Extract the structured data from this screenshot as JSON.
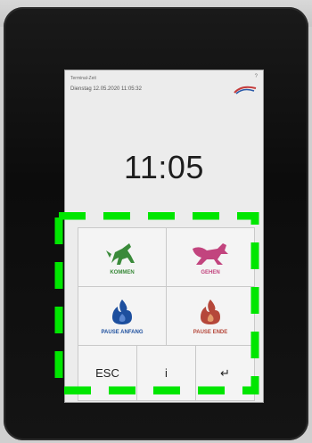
{
  "header": {
    "device_name": "Terminal-Zeit",
    "datetime": "Dienstag 12.05.2020 11:05:32",
    "help_glyph": "?"
  },
  "clock": {
    "time": "11:05"
  },
  "pad": {
    "buttons": [
      {
        "label": "KOMMEN",
        "icon": "arrive-animal-icon",
        "color": "#3a8a3a"
      },
      {
        "label": "GEHEN",
        "icon": "leave-animal-icon",
        "color": "#c2447e"
      },
      {
        "label": "PAUSE ANFANG",
        "icon": "pause-start-flame-icon",
        "color": "#1d4f9e"
      },
      {
        "label": "PAUSE ENDE",
        "icon": "pause-end-flame-icon",
        "color": "#b5473a"
      }
    ],
    "keys": {
      "esc": "ESC",
      "info": "i",
      "enter": "↵"
    }
  },
  "overlay": {
    "color": "#00e600",
    "style": "dashed"
  }
}
